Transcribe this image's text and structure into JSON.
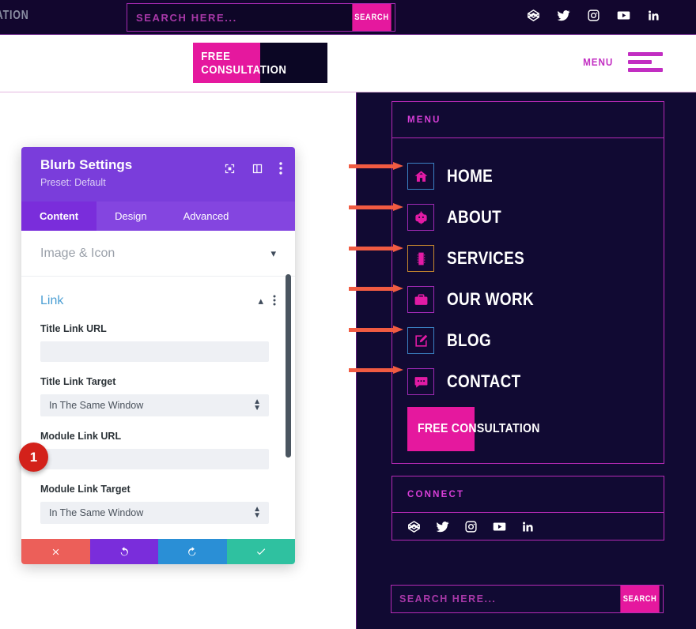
{
  "topbar": {
    "left_text": "ULTATION",
    "search": {
      "placeholder": "SEARCH HERE...",
      "value": "",
      "button_label": "SEARCH"
    },
    "social": [
      {
        "name": "codepen-icon"
      },
      {
        "name": "twitter-icon"
      },
      {
        "name": "instagram-icon"
      },
      {
        "name": "youtube-icon"
      },
      {
        "name": "linkedin-icon"
      }
    ]
  },
  "header": {
    "logo_text": "FREE CONSULTATION",
    "menu_label": "MENU"
  },
  "sidebar": {
    "menu_widget_title": "MENU",
    "items": [
      {
        "label": "HOME",
        "icon": "home-icon",
        "border_color": "#3b82c4"
      },
      {
        "label": "ABOUT",
        "icon": "robot-icon",
        "border_color": "#a02ab5"
      },
      {
        "label": "SERVICES",
        "icon": "chip-icon",
        "border_color": "#c98a2e"
      },
      {
        "label": "OUR WORK",
        "icon": "briefcase-icon",
        "border_color": "#a02ab5"
      },
      {
        "label": "BLOG",
        "icon": "edit-icon",
        "border_color": "#3b82c4"
      },
      {
        "label": "CONTACT",
        "icon": "comment-icon",
        "border_color": "#a02ab5"
      }
    ],
    "cta_label": "FREE CONSULTATION",
    "connect_widget_title": "CONNECT",
    "connect_icons": [
      {
        "name": "codepen-icon"
      },
      {
        "name": "twitter-icon"
      },
      {
        "name": "instagram-icon"
      },
      {
        "name": "youtube-icon"
      },
      {
        "name": "linkedin-icon"
      }
    ],
    "search": {
      "placeholder": "SEARCH HERE...",
      "value": "",
      "button_label": "SEARCH"
    }
  },
  "modal": {
    "title": "Blurb Settings",
    "preset": "Preset: Default",
    "tabs": [
      {
        "label": "Content",
        "active": true
      },
      {
        "label": "Design",
        "active": false
      },
      {
        "label": "Advanced",
        "active": false
      }
    ],
    "closed_section": {
      "label": "Image & Icon"
    },
    "open_section": {
      "label": "Link"
    },
    "fields": [
      {
        "label": "Title Link URL",
        "type": "text",
        "value": ""
      },
      {
        "label": "Title Link Target",
        "type": "select",
        "value": "In The Same Window"
      },
      {
        "label": "Module Link URL",
        "type": "text",
        "value": ""
      },
      {
        "label": "Module Link Target",
        "type": "select",
        "value": "In The Same Window"
      }
    ],
    "footer_buttons": [
      {
        "name": "cancel-button",
        "icon": "close-icon"
      },
      {
        "name": "undo-button",
        "icon": "undo-icon"
      },
      {
        "name": "redo-button",
        "icon": "redo-icon"
      },
      {
        "name": "save-button",
        "icon": "check-icon"
      }
    ]
  },
  "annotation": {
    "badge_number": "1",
    "accent_color": "#f15b42"
  },
  "colors": {
    "pink": "#e5189e",
    "purple": "#7a3ddb",
    "dark_navy": "#110a33",
    "magenta_border": "#b52ab5"
  }
}
